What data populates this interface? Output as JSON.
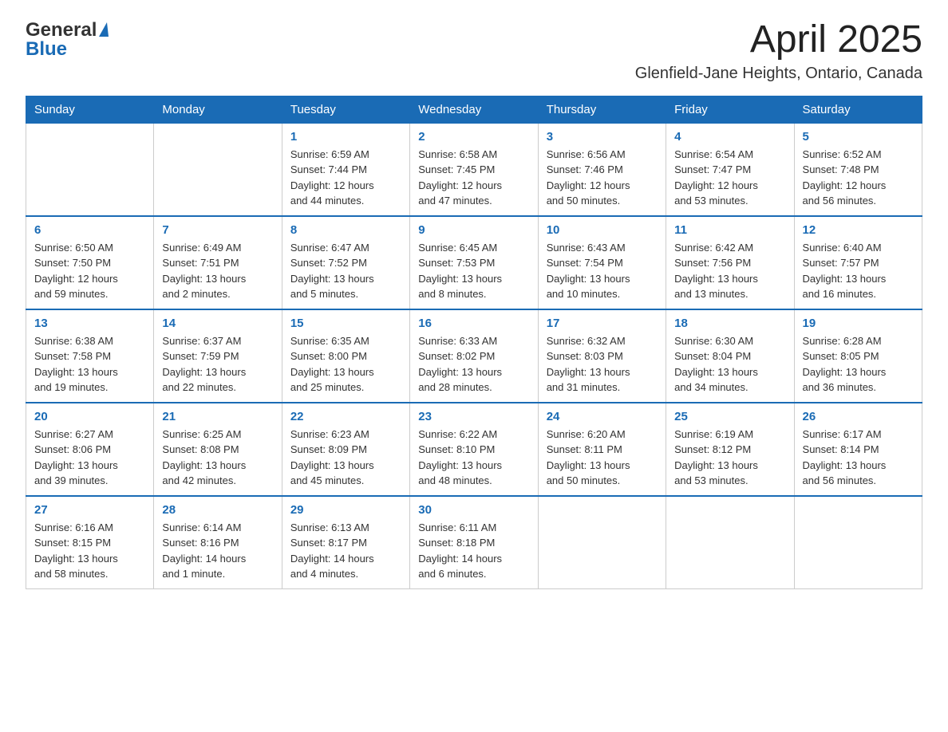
{
  "header": {
    "logo_general": "General",
    "logo_blue": "Blue",
    "month": "April 2025",
    "location": "Glenfield-Jane Heights, Ontario, Canada"
  },
  "weekdays": [
    "Sunday",
    "Monday",
    "Tuesday",
    "Wednesday",
    "Thursday",
    "Friday",
    "Saturday"
  ],
  "weeks": [
    [
      {
        "day": "",
        "info": ""
      },
      {
        "day": "",
        "info": ""
      },
      {
        "day": "1",
        "info": "Sunrise: 6:59 AM\nSunset: 7:44 PM\nDaylight: 12 hours\nand 44 minutes."
      },
      {
        "day": "2",
        "info": "Sunrise: 6:58 AM\nSunset: 7:45 PM\nDaylight: 12 hours\nand 47 minutes."
      },
      {
        "day": "3",
        "info": "Sunrise: 6:56 AM\nSunset: 7:46 PM\nDaylight: 12 hours\nand 50 minutes."
      },
      {
        "day": "4",
        "info": "Sunrise: 6:54 AM\nSunset: 7:47 PM\nDaylight: 12 hours\nand 53 minutes."
      },
      {
        "day": "5",
        "info": "Sunrise: 6:52 AM\nSunset: 7:48 PM\nDaylight: 12 hours\nand 56 minutes."
      }
    ],
    [
      {
        "day": "6",
        "info": "Sunrise: 6:50 AM\nSunset: 7:50 PM\nDaylight: 12 hours\nand 59 minutes."
      },
      {
        "day": "7",
        "info": "Sunrise: 6:49 AM\nSunset: 7:51 PM\nDaylight: 13 hours\nand 2 minutes."
      },
      {
        "day": "8",
        "info": "Sunrise: 6:47 AM\nSunset: 7:52 PM\nDaylight: 13 hours\nand 5 minutes."
      },
      {
        "day": "9",
        "info": "Sunrise: 6:45 AM\nSunset: 7:53 PM\nDaylight: 13 hours\nand 8 minutes."
      },
      {
        "day": "10",
        "info": "Sunrise: 6:43 AM\nSunset: 7:54 PM\nDaylight: 13 hours\nand 10 minutes."
      },
      {
        "day": "11",
        "info": "Sunrise: 6:42 AM\nSunset: 7:56 PM\nDaylight: 13 hours\nand 13 minutes."
      },
      {
        "day": "12",
        "info": "Sunrise: 6:40 AM\nSunset: 7:57 PM\nDaylight: 13 hours\nand 16 minutes."
      }
    ],
    [
      {
        "day": "13",
        "info": "Sunrise: 6:38 AM\nSunset: 7:58 PM\nDaylight: 13 hours\nand 19 minutes."
      },
      {
        "day": "14",
        "info": "Sunrise: 6:37 AM\nSunset: 7:59 PM\nDaylight: 13 hours\nand 22 minutes."
      },
      {
        "day": "15",
        "info": "Sunrise: 6:35 AM\nSunset: 8:00 PM\nDaylight: 13 hours\nand 25 minutes."
      },
      {
        "day": "16",
        "info": "Sunrise: 6:33 AM\nSunset: 8:02 PM\nDaylight: 13 hours\nand 28 minutes."
      },
      {
        "day": "17",
        "info": "Sunrise: 6:32 AM\nSunset: 8:03 PM\nDaylight: 13 hours\nand 31 minutes."
      },
      {
        "day": "18",
        "info": "Sunrise: 6:30 AM\nSunset: 8:04 PM\nDaylight: 13 hours\nand 34 minutes."
      },
      {
        "day": "19",
        "info": "Sunrise: 6:28 AM\nSunset: 8:05 PM\nDaylight: 13 hours\nand 36 minutes."
      }
    ],
    [
      {
        "day": "20",
        "info": "Sunrise: 6:27 AM\nSunset: 8:06 PM\nDaylight: 13 hours\nand 39 minutes."
      },
      {
        "day": "21",
        "info": "Sunrise: 6:25 AM\nSunset: 8:08 PM\nDaylight: 13 hours\nand 42 minutes."
      },
      {
        "day": "22",
        "info": "Sunrise: 6:23 AM\nSunset: 8:09 PM\nDaylight: 13 hours\nand 45 minutes."
      },
      {
        "day": "23",
        "info": "Sunrise: 6:22 AM\nSunset: 8:10 PM\nDaylight: 13 hours\nand 48 minutes."
      },
      {
        "day": "24",
        "info": "Sunrise: 6:20 AM\nSunset: 8:11 PM\nDaylight: 13 hours\nand 50 minutes."
      },
      {
        "day": "25",
        "info": "Sunrise: 6:19 AM\nSunset: 8:12 PM\nDaylight: 13 hours\nand 53 minutes."
      },
      {
        "day": "26",
        "info": "Sunrise: 6:17 AM\nSunset: 8:14 PM\nDaylight: 13 hours\nand 56 minutes."
      }
    ],
    [
      {
        "day": "27",
        "info": "Sunrise: 6:16 AM\nSunset: 8:15 PM\nDaylight: 13 hours\nand 58 minutes."
      },
      {
        "day": "28",
        "info": "Sunrise: 6:14 AM\nSunset: 8:16 PM\nDaylight: 14 hours\nand 1 minute."
      },
      {
        "day": "29",
        "info": "Sunrise: 6:13 AM\nSunset: 8:17 PM\nDaylight: 14 hours\nand 4 minutes."
      },
      {
        "day": "30",
        "info": "Sunrise: 6:11 AM\nSunset: 8:18 PM\nDaylight: 14 hours\nand 6 minutes."
      },
      {
        "day": "",
        "info": ""
      },
      {
        "day": "",
        "info": ""
      },
      {
        "day": "",
        "info": ""
      }
    ]
  ]
}
